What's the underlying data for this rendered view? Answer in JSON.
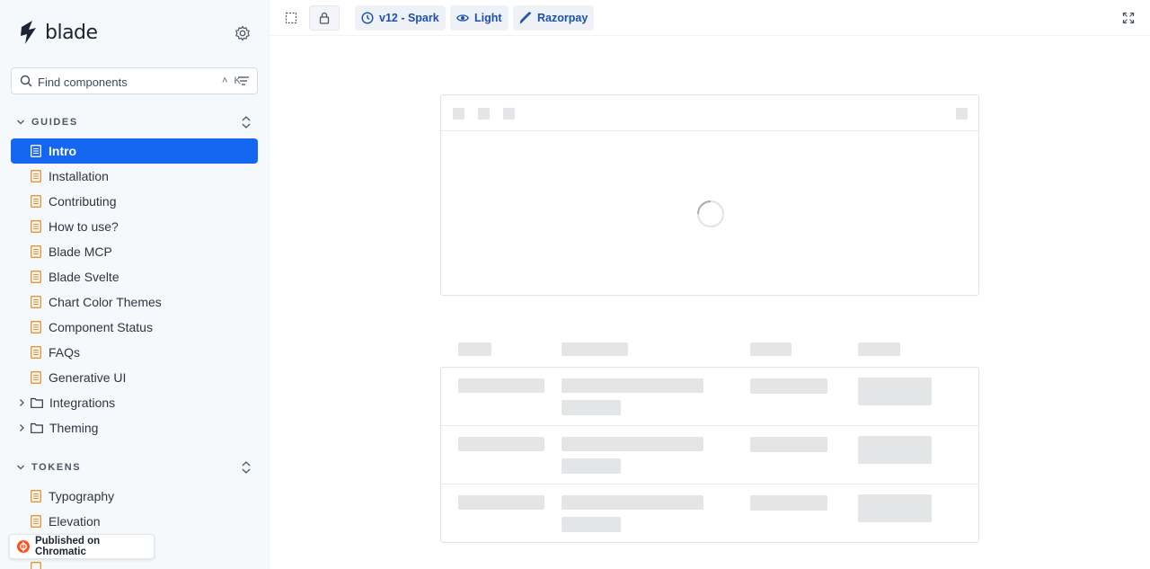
{
  "brand": {
    "name": "blade"
  },
  "search": {
    "placeholder": "Find components",
    "shortcut": "˄ K"
  },
  "sections": {
    "guides": {
      "label": "GUIDES"
    },
    "tokens": {
      "label": "TOKENS"
    }
  },
  "guides_items": [
    {
      "label": "Intro",
      "active": true
    },
    {
      "label": "Installation"
    },
    {
      "label": "Contributing"
    },
    {
      "label": "How to use?"
    },
    {
      "label": "Blade MCP"
    },
    {
      "label": "Blade Svelte"
    },
    {
      "label": "Chart Color Themes"
    },
    {
      "label": "Component Status"
    },
    {
      "label": "FAQs"
    },
    {
      "label": "Generative UI"
    }
  ],
  "guides_folders": [
    {
      "label": "Integrations"
    },
    {
      "label": "Theming"
    }
  ],
  "tokens_items": [
    {
      "label": "Typography"
    },
    {
      "label": "Elevation"
    }
  ],
  "chromatic": {
    "label": "Published on Chromatic"
  },
  "toolbar": {
    "version": "v12 - Spark",
    "theme": "Light",
    "brand": "Razorpay"
  },
  "colors": {
    "accent": "#1566f0",
    "doc_icon": "#e6932e",
    "pill_text": "#1c4fb0",
    "skeleton": "#e4e5e7"
  }
}
